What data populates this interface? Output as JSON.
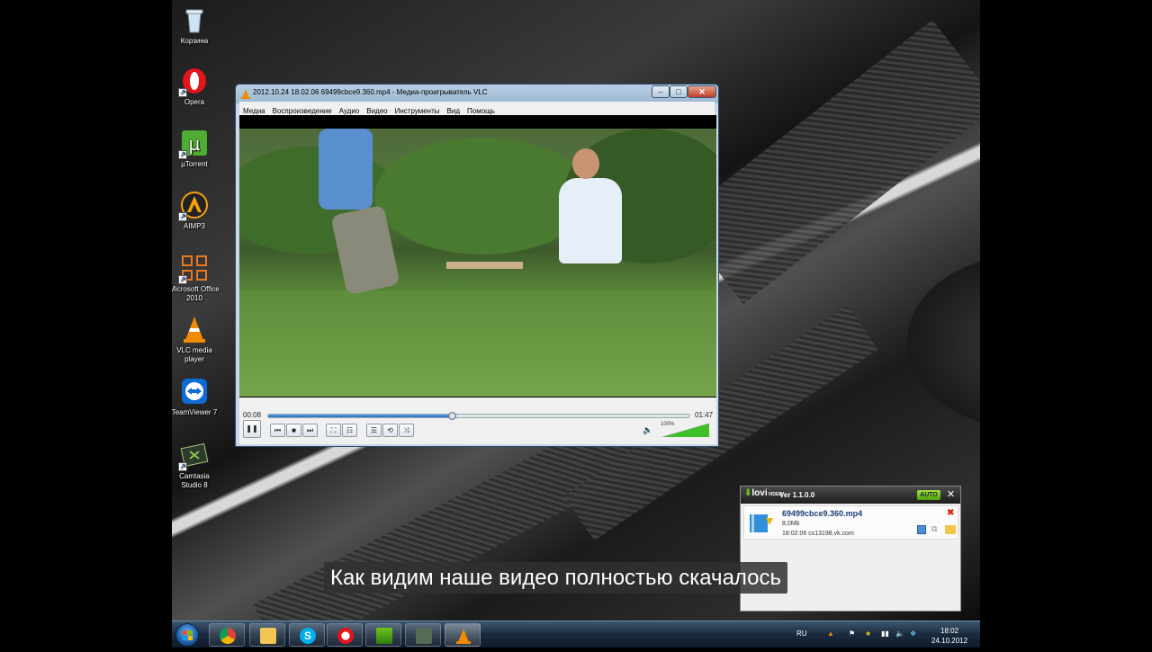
{
  "desktop": {
    "icons": [
      {
        "label": "Корзина"
      },
      {
        "label": "Opera"
      },
      {
        "label": "µTorrent"
      },
      {
        "label": "AIMP3"
      },
      {
        "label": "Microsoft Office 2010"
      },
      {
        "label": "VLC media player"
      },
      {
        "label": "TeamViewer 7"
      },
      {
        "label": "Camtasia Studio 8"
      }
    ]
  },
  "vlc": {
    "title": "2012.10.24 18.02.06 69499cbce9.360.mp4 - Медиа-проигрыватель VLC",
    "window_buttons": {
      "minimize": "–",
      "maximize": "□",
      "close": "✕"
    },
    "menu": [
      "Медиа",
      "Воспроизведение",
      "Аудио",
      "Видео",
      "Инструменты",
      "Вид",
      "Помощь"
    ],
    "elapsed": "00:08",
    "total": "01:47",
    "progress_fraction": 0.435,
    "volume_label": "100%",
    "volume_fraction": 1.0,
    "controls": {
      "play_pause": "❚❚",
      "prev": "⏮",
      "stop": "■",
      "next": "⏭",
      "fullscreen": "⛶",
      "ext_settings": "☷",
      "playlist": "☰",
      "loop": "⟲",
      "shuffle": "⤨",
      "volume_icon": "🔈"
    }
  },
  "lovi": {
    "logo": "lovi",
    "logo_sub": "VIDEO",
    "version": "Ver 1.1.0.0",
    "auto": "AUTO",
    "close": "✕",
    "item": {
      "filename": "69499cbce9.360.mp4",
      "size": "8,0Mb",
      "meta": "18:02:06 cs13198.vk.com"
    }
  },
  "subtitle": "Как видим наше видео полностью скачалось",
  "taskbar": {
    "lang": "RU",
    "time": "18:02",
    "date": "24.10.2012"
  },
  "colors": {
    "vlc_orange": "#f08a00",
    "seek_blue": "#1f6bbf",
    "lovi_green": "#6fc41a"
  }
}
